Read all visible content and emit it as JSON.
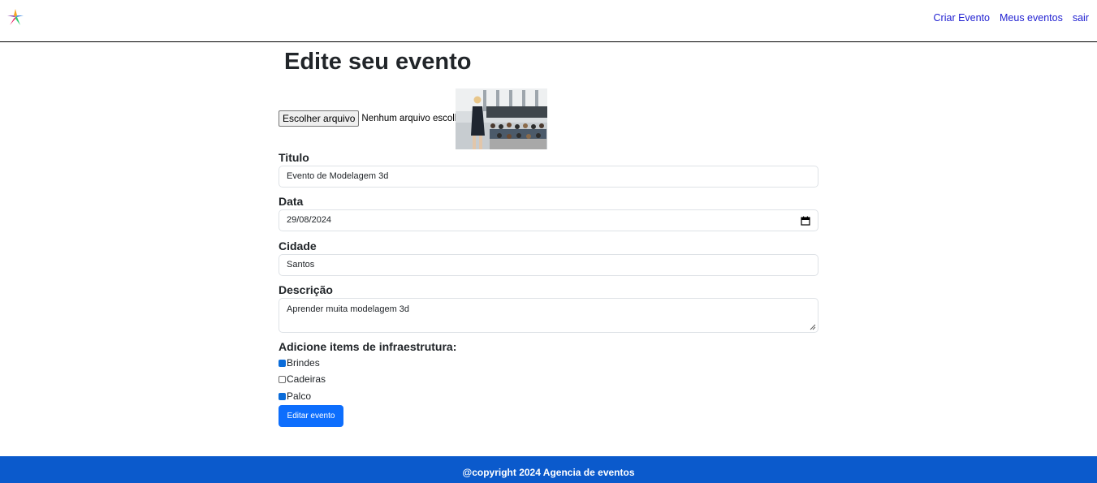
{
  "nav": {
    "logo_icon": "colorful-star-logo",
    "links": [
      "Criar Evento",
      "Meus eventos",
      "sair"
    ]
  },
  "page": {
    "title": "Edite seu evento"
  },
  "form": {
    "file": {
      "button_label": "Escolher arquivo",
      "status": "Nenhum arquivo escolhido"
    },
    "title": {
      "label": "Titulo",
      "value": "Evento de Modelagem 3d"
    },
    "date": {
      "label": "Data",
      "value": "29/08/2024",
      "icon": "calendar-icon"
    },
    "city": {
      "label": "Cidade",
      "value": "Santos"
    },
    "description": {
      "label": "Descrição",
      "value": "Aprender muita modelagem 3d"
    },
    "infrastructure": {
      "label": "Adicione items de infraestrutura:",
      "items": [
        {
          "label": "Brindes",
          "checked": true
        },
        {
          "label": "Cadeiras",
          "checked": false
        },
        {
          "label": "Palco",
          "checked": true
        }
      ]
    },
    "submit_label": "Editar evento"
  },
  "footer": {
    "text": "@copyright 2024 Agencia de eventos"
  },
  "colors": {
    "primary": "#0d6efd",
    "footer": "#0b5acc",
    "nav_link": "#1f1fd1",
    "checkbox_checked": "#0b6cd9"
  }
}
